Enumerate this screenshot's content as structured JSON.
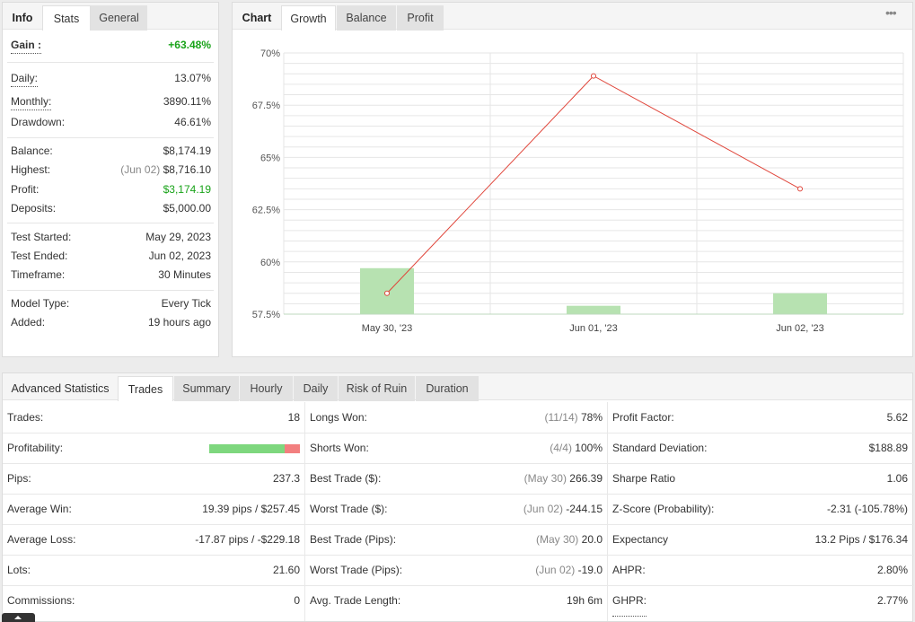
{
  "info_panel": {
    "tabs": [
      "Info",
      "Stats",
      "General"
    ],
    "gain": {
      "label": "Gain :",
      "value": "+63.48%"
    },
    "daily": {
      "label": "Daily:",
      "value": "13.07%"
    },
    "monthly": {
      "label": "Monthly:",
      "value": "3890.11%"
    },
    "drawdown": {
      "label": "Drawdown:",
      "value": "46.61%"
    },
    "balance": {
      "label": "Balance:",
      "value": "$8,174.19"
    },
    "highest": {
      "label": "Highest:",
      "date": "(Jun 02)",
      "value": "$8,716.10"
    },
    "profit": {
      "label": "Profit:",
      "value": "$3,174.19"
    },
    "deposits": {
      "label": "Deposits:",
      "value": "$5,000.00"
    },
    "test_started": {
      "label": "Test Started:",
      "value": "May 29, 2023"
    },
    "test_ended": {
      "label": "Test Ended:",
      "value": "Jun 02, 2023"
    },
    "timeframe": {
      "label": "Timeframe:",
      "value": "30 Minutes"
    },
    "model_type": {
      "label": "Model Type:",
      "value": "Every Tick"
    },
    "added": {
      "label": "Added:",
      "value": "19 hours ago"
    }
  },
  "chart_panel": {
    "tabs": [
      "Chart",
      "Growth",
      "Balance",
      "Profit"
    ],
    "more_icon": "more-dots-icon",
    "colors": {
      "line": "#e0453a",
      "bar": "#b7e2b1",
      "grid": "#e6e6e6"
    }
  },
  "chart_data": {
    "type": "bar",
    "categories": [
      "May 30, '23",
      "Jun 01, '23",
      "Jun 02, '23"
    ],
    "series": [
      {
        "type": "bar",
        "values": [
          59.7,
          57.9,
          58.5
        ]
      },
      {
        "type": "line",
        "values": [
          58.5,
          68.9,
          63.5
        ]
      }
    ],
    "y_ticks": [
      "70%",
      "67.5%",
      "65%",
      "62.5%",
      "60%",
      "57.5%"
    ],
    "ylim": [
      57.5,
      70
    ],
    "grid": true
  },
  "advanced": {
    "tabs": [
      "Advanced Statistics",
      "Trades",
      "Summary",
      "Hourly",
      "Daily",
      "Risk of Ruin",
      "Duration"
    ],
    "col1": [
      {
        "label": "Trades:",
        "value": "18"
      },
      {
        "label": "Profitability:",
        "win_fraction": 0.83
      },
      {
        "label": "Pips:",
        "value": "237.3"
      },
      {
        "label": "Average Win:",
        "value": "19.39 pips / $257.45"
      },
      {
        "label": "Average Loss:",
        "value": "-17.87 pips / -$229.18"
      },
      {
        "label": "Lots:",
        "value": "21.60"
      },
      {
        "label": "Commissions:",
        "value": "0"
      }
    ],
    "col2": [
      {
        "label": "Longs Won:",
        "muted": "(11/14)",
        "value": "78%"
      },
      {
        "label": "Shorts Won:",
        "muted": "(4/4)",
        "value": "100%"
      },
      {
        "label": "Best Trade ($):",
        "muted": "(May 30)",
        "value": "266.39"
      },
      {
        "label": "Worst Trade ($):",
        "muted": "(Jun 02)",
        "value": "-244.15"
      },
      {
        "label": "Best Trade (Pips):",
        "muted": "(May 30)",
        "value": "20.0"
      },
      {
        "label": "Worst Trade (Pips):",
        "muted": "(Jun 02)",
        "value": "-19.0"
      },
      {
        "label": "Avg. Trade Length:",
        "muted": "",
        "value": "19h 6m"
      }
    ],
    "col3": [
      {
        "label": "Profit Factor:",
        "value": "5.62"
      },
      {
        "label": "Standard Deviation:",
        "value": "$188.89"
      },
      {
        "label": "Sharpe Ratio",
        "value": "1.06"
      },
      {
        "label": "Z-Score (Probability):",
        "value": "-2.31 (-105.78%)"
      },
      {
        "label": "Expectancy",
        "value": "13.2 Pips / $176.34"
      },
      {
        "label": "AHPR:",
        "value": "2.80%"
      },
      {
        "label": "GHPR:",
        "value": "2.77%"
      }
    ]
  }
}
